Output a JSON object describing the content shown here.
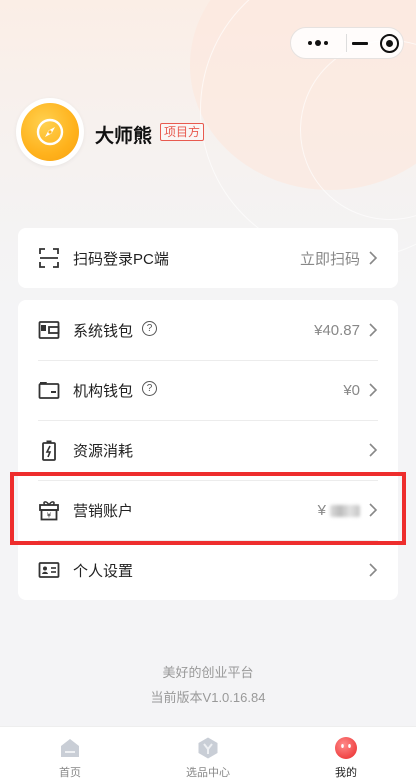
{
  "capsule": {
    "more_icon": "more-dots-icon",
    "minimize_icon": "minimize-icon",
    "close_icon": "target-close-icon"
  },
  "profile": {
    "avatar_icon": "compass-icon",
    "name": "大师熊",
    "role": "项目方"
  },
  "scan_card": {
    "label": "扫码登录PC端",
    "action": "立即扫码",
    "icon": "scan-icon"
  },
  "menu": {
    "items": [
      {
        "label": "系统钱包",
        "value": "¥40.87",
        "has_help": true,
        "icon": "wallet-icon"
      },
      {
        "label": "机构钱包",
        "value": "¥0",
        "has_help": true,
        "icon": "wallet-outline-icon"
      },
      {
        "label": "资源消耗",
        "value": "",
        "has_help": false,
        "icon": "battery-charge-icon"
      },
      {
        "label": "营销账户",
        "value": "¥",
        "value_blurred": true,
        "has_help": false,
        "icon": "gift-box-icon"
      },
      {
        "label": "个人设置",
        "value": "",
        "has_help": false,
        "icon": "id-card-icon"
      }
    ],
    "help_glyph": "?"
  },
  "footer": {
    "slogan": "美好的创业平台",
    "version": "当前版本V1.0.16.84"
  },
  "tabbar": {
    "tabs": [
      {
        "label": "首页",
        "icon": "home-icon",
        "active": false
      },
      {
        "label": "选品中心",
        "icon": "selection-center-icon",
        "active": false
      },
      {
        "label": "我的",
        "icon": "profile-face-icon",
        "active": true
      }
    ]
  },
  "colors": {
    "highlight": "#ee2d2d",
    "badge": "#e85a4f",
    "avatar": "#ffb21c",
    "profile_tab": "#f45454"
  }
}
